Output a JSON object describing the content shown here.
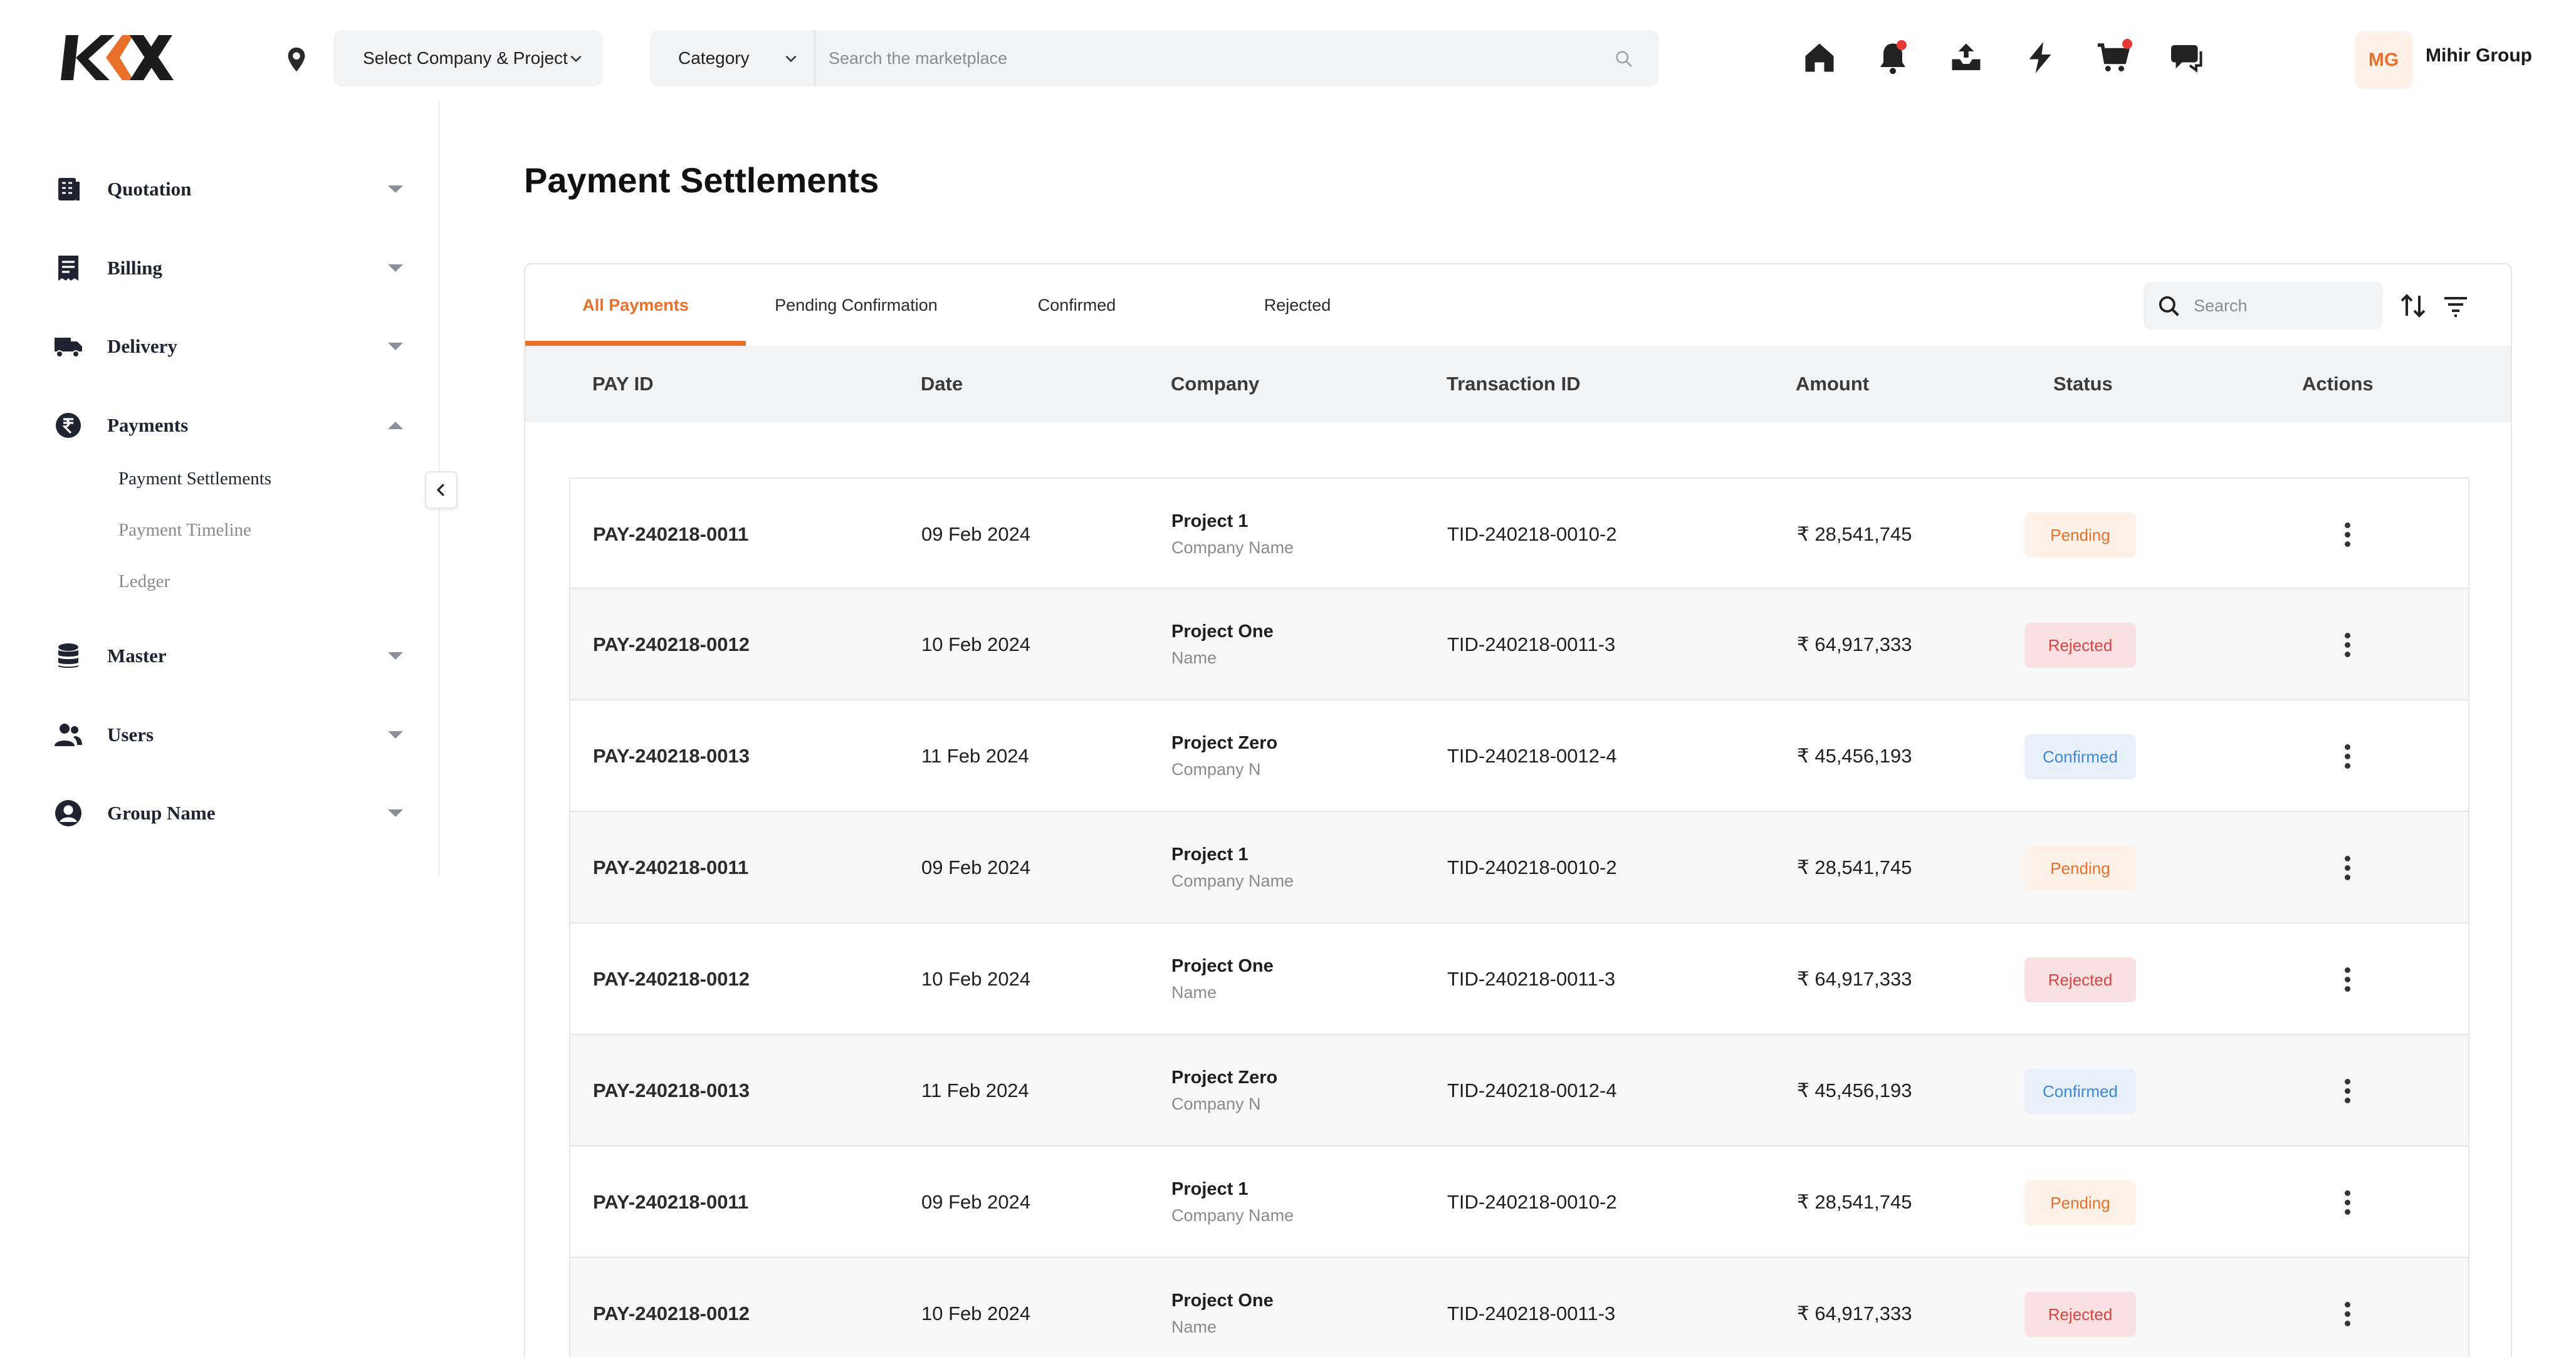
{
  "header": {
    "company_select_label": "Select Company & Project",
    "category_label": "Category",
    "search_placeholder": "Search the marketplace",
    "user": {
      "initials": "MG",
      "name": "Mihir Group"
    }
  },
  "sidebar": {
    "items": [
      {
        "label": "Quotation",
        "icon": "quotation-icon",
        "expanded": false
      },
      {
        "label": "Billing",
        "icon": "billing-icon",
        "expanded": false
      },
      {
        "label": "Delivery",
        "icon": "delivery-truck-icon",
        "expanded": false
      },
      {
        "label": "Payments",
        "icon": "rupee-icon",
        "expanded": true
      },
      {
        "label": "Master",
        "icon": "database-icon",
        "expanded": false
      },
      {
        "label": "Users",
        "icon": "users-icon",
        "expanded": false
      },
      {
        "label": "Group Name",
        "icon": "user-circle-icon",
        "expanded": false
      }
    ],
    "payments_sub": [
      "Payment Settlements",
      "Payment Timeline",
      "Ledger"
    ]
  },
  "page": {
    "title": "Payment Settlements"
  },
  "tabs": [
    "All Payments",
    "Pending Confirmation",
    "Confirmed",
    "Rejected"
  ],
  "table_search_placeholder": "Search",
  "columns": [
    "PAY ID",
    "Date",
    "Company",
    "Transaction ID",
    "Amount",
    "Status",
    "Actions"
  ],
  "rows": [
    {
      "pay_id": "PAY-240218-0011",
      "date": "09 Feb 2024",
      "project": "Project 1",
      "company": "Company Name",
      "transaction_id": "TID-240218-0010-2",
      "amount": "₹ 28,541,745",
      "status": "Pending"
    },
    {
      "pay_id": "PAY-240218-0012",
      "date": "10 Feb 2024",
      "project": "Project One",
      "company": "Name",
      "transaction_id": "TID-240218-0011-3",
      "amount": "₹ 64,917,333",
      "status": "Rejected"
    },
    {
      "pay_id": "PAY-240218-0013",
      "date": "11 Feb 2024",
      "project": "Project Zero",
      "company": "Company N",
      "transaction_id": "TID-240218-0012-4",
      "amount": "₹ 45,456,193",
      "status": "Confirmed"
    },
    {
      "pay_id": "PAY-240218-0011",
      "date": "09 Feb 2024",
      "project": "Project 1",
      "company": "Company Name",
      "transaction_id": "TID-240218-0010-2",
      "amount": "₹ 28,541,745",
      "status": "Pending"
    },
    {
      "pay_id": "PAY-240218-0012",
      "date": "10 Feb 2024",
      "project": "Project One",
      "company": "Name",
      "transaction_id": "TID-240218-0011-3",
      "amount": "₹ 64,917,333",
      "status": "Rejected"
    },
    {
      "pay_id": "PAY-240218-0013",
      "date": "11 Feb 2024",
      "project": "Project Zero",
      "company": "Company N",
      "transaction_id": "TID-240218-0012-4",
      "amount": "₹ 45,456,193",
      "status": "Confirmed"
    },
    {
      "pay_id": "PAY-240218-0011",
      "date": "09 Feb 2024",
      "project": "Project 1",
      "company": "Company Name",
      "transaction_id": "TID-240218-0010-2",
      "amount": "₹ 28,541,745",
      "status": "Pending"
    },
    {
      "pay_id": "PAY-240218-0012",
      "date": "10 Feb 2024",
      "project": "Project One",
      "company": "Name",
      "transaction_id": "TID-240218-0011-3",
      "amount": "₹ 64,917,333",
      "status": "Rejected"
    }
  ],
  "colors": {
    "accent": "#e8702a",
    "pending_bg": "#fdf1e8",
    "rejected_bg": "#f9e1e1",
    "rejected_text": "#d64545",
    "confirmed_bg": "#e8f1fb",
    "confirmed_text": "#3f86d6",
    "notification_dot": "#e53935"
  }
}
